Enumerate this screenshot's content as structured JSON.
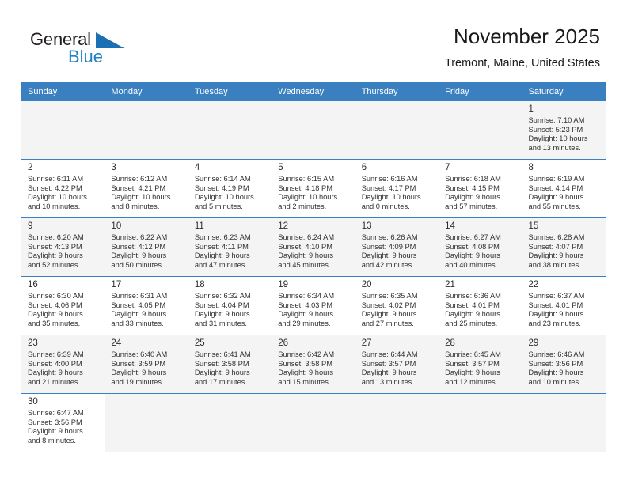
{
  "brand": {
    "name_top": "General",
    "name_bottom": "Blue",
    "flag_icon": "blue-triangle-flag-icon",
    "color_top": "#231f20",
    "color_bottom": "#2280c4"
  },
  "header": {
    "title": "November 2025",
    "subtitle": "Tremont, Maine, United States"
  },
  "theme": {
    "header_bg": "#3a7fbf",
    "header_text": "#ffffff",
    "row_shaded": "#f4f4f4",
    "row_plain": "#ffffff",
    "row_border": "#3a7fbf"
  },
  "calendar": {
    "weekday_headers": [
      "Sunday",
      "Monday",
      "Tuesday",
      "Wednesday",
      "Thursday",
      "Friday",
      "Saturday"
    ],
    "labels": {
      "sunrise": "Sunrise:",
      "sunset": "Sunset:",
      "daylight": "Daylight:"
    },
    "weeks": [
      [
        null,
        null,
        null,
        null,
        null,
        null,
        {
          "day": "1",
          "sunrise": "Sunrise: 7:10 AM",
          "sunset": "Sunset: 5:23 PM",
          "daylight_line1": "Daylight: 10 hours",
          "daylight_line2": "and 13 minutes."
        }
      ],
      [
        {
          "day": "2",
          "sunrise": "Sunrise: 6:11 AM",
          "sunset": "Sunset: 4:22 PM",
          "daylight_line1": "Daylight: 10 hours",
          "daylight_line2": "and 10 minutes."
        },
        {
          "day": "3",
          "sunrise": "Sunrise: 6:12 AM",
          "sunset": "Sunset: 4:21 PM",
          "daylight_line1": "Daylight: 10 hours",
          "daylight_line2": "and 8 minutes."
        },
        {
          "day": "4",
          "sunrise": "Sunrise: 6:14 AM",
          "sunset": "Sunset: 4:19 PM",
          "daylight_line1": "Daylight: 10 hours",
          "daylight_line2": "and 5 minutes."
        },
        {
          "day": "5",
          "sunrise": "Sunrise: 6:15 AM",
          "sunset": "Sunset: 4:18 PM",
          "daylight_line1": "Daylight: 10 hours",
          "daylight_line2": "and 2 minutes."
        },
        {
          "day": "6",
          "sunrise": "Sunrise: 6:16 AM",
          "sunset": "Sunset: 4:17 PM",
          "daylight_line1": "Daylight: 10 hours",
          "daylight_line2": "and 0 minutes."
        },
        {
          "day": "7",
          "sunrise": "Sunrise: 6:18 AM",
          "sunset": "Sunset: 4:15 PM",
          "daylight_line1": "Daylight: 9 hours",
          "daylight_line2": "and 57 minutes."
        },
        {
          "day": "8",
          "sunrise": "Sunrise: 6:19 AM",
          "sunset": "Sunset: 4:14 PM",
          "daylight_line1": "Daylight: 9 hours",
          "daylight_line2": "and 55 minutes."
        }
      ],
      [
        {
          "day": "9",
          "sunrise": "Sunrise: 6:20 AM",
          "sunset": "Sunset: 4:13 PM",
          "daylight_line1": "Daylight: 9 hours",
          "daylight_line2": "and 52 minutes."
        },
        {
          "day": "10",
          "sunrise": "Sunrise: 6:22 AM",
          "sunset": "Sunset: 4:12 PM",
          "daylight_line1": "Daylight: 9 hours",
          "daylight_line2": "and 50 minutes."
        },
        {
          "day": "11",
          "sunrise": "Sunrise: 6:23 AM",
          "sunset": "Sunset: 4:11 PM",
          "daylight_line1": "Daylight: 9 hours",
          "daylight_line2": "and 47 minutes."
        },
        {
          "day": "12",
          "sunrise": "Sunrise: 6:24 AM",
          "sunset": "Sunset: 4:10 PM",
          "daylight_line1": "Daylight: 9 hours",
          "daylight_line2": "and 45 minutes."
        },
        {
          "day": "13",
          "sunrise": "Sunrise: 6:26 AM",
          "sunset": "Sunset: 4:09 PM",
          "daylight_line1": "Daylight: 9 hours",
          "daylight_line2": "and 42 minutes."
        },
        {
          "day": "14",
          "sunrise": "Sunrise: 6:27 AM",
          "sunset": "Sunset: 4:08 PM",
          "daylight_line1": "Daylight: 9 hours",
          "daylight_line2": "and 40 minutes."
        },
        {
          "day": "15",
          "sunrise": "Sunrise: 6:28 AM",
          "sunset": "Sunset: 4:07 PM",
          "daylight_line1": "Daylight: 9 hours",
          "daylight_line2": "and 38 minutes."
        }
      ],
      [
        {
          "day": "16",
          "sunrise": "Sunrise: 6:30 AM",
          "sunset": "Sunset: 4:06 PM",
          "daylight_line1": "Daylight: 9 hours",
          "daylight_line2": "and 35 minutes."
        },
        {
          "day": "17",
          "sunrise": "Sunrise: 6:31 AM",
          "sunset": "Sunset: 4:05 PM",
          "daylight_line1": "Daylight: 9 hours",
          "daylight_line2": "and 33 minutes."
        },
        {
          "day": "18",
          "sunrise": "Sunrise: 6:32 AM",
          "sunset": "Sunset: 4:04 PM",
          "daylight_line1": "Daylight: 9 hours",
          "daylight_line2": "and 31 minutes."
        },
        {
          "day": "19",
          "sunrise": "Sunrise: 6:34 AM",
          "sunset": "Sunset: 4:03 PM",
          "daylight_line1": "Daylight: 9 hours",
          "daylight_line2": "and 29 minutes."
        },
        {
          "day": "20",
          "sunrise": "Sunrise: 6:35 AM",
          "sunset": "Sunset: 4:02 PM",
          "daylight_line1": "Daylight: 9 hours",
          "daylight_line2": "and 27 minutes."
        },
        {
          "day": "21",
          "sunrise": "Sunrise: 6:36 AM",
          "sunset": "Sunset: 4:01 PM",
          "daylight_line1": "Daylight: 9 hours",
          "daylight_line2": "and 25 minutes."
        },
        {
          "day": "22",
          "sunrise": "Sunrise: 6:37 AM",
          "sunset": "Sunset: 4:01 PM",
          "daylight_line1": "Daylight: 9 hours",
          "daylight_line2": "and 23 minutes."
        }
      ],
      [
        {
          "day": "23",
          "sunrise": "Sunrise: 6:39 AM",
          "sunset": "Sunset: 4:00 PM",
          "daylight_line1": "Daylight: 9 hours",
          "daylight_line2": "and 21 minutes."
        },
        {
          "day": "24",
          "sunrise": "Sunrise: 6:40 AM",
          "sunset": "Sunset: 3:59 PM",
          "daylight_line1": "Daylight: 9 hours",
          "daylight_line2": "and 19 minutes."
        },
        {
          "day": "25",
          "sunrise": "Sunrise: 6:41 AM",
          "sunset": "Sunset: 3:58 PM",
          "daylight_line1": "Daylight: 9 hours",
          "daylight_line2": "and 17 minutes."
        },
        {
          "day": "26",
          "sunrise": "Sunrise: 6:42 AM",
          "sunset": "Sunset: 3:58 PM",
          "daylight_line1": "Daylight: 9 hours",
          "daylight_line2": "and 15 minutes."
        },
        {
          "day": "27",
          "sunrise": "Sunrise: 6:44 AM",
          "sunset": "Sunset: 3:57 PM",
          "daylight_line1": "Daylight: 9 hours",
          "daylight_line2": "and 13 minutes."
        },
        {
          "day": "28",
          "sunrise": "Sunrise: 6:45 AM",
          "sunset": "Sunset: 3:57 PM",
          "daylight_line1": "Daylight: 9 hours",
          "daylight_line2": "and 12 minutes."
        },
        {
          "day": "29",
          "sunrise": "Sunrise: 6:46 AM",
          "sunset": "Sunset: 3:56 PM",
          "daylight_line1": "Daylight: 9 hours",
          "daylight_line2": "and 10 minutes."
        }
      ],
      [
        {
          "day": "30",
          "sunrise": "Sunrise: 6:47 AM",
          "sunset": "Sunset: 3:56 PM",
          "daylight_line1": "Daylight: 9 hours",
          "daylight_line2": "and 8 minutes."
        },
        null,
        null,
        null,
        null,
        null,
        null
      ]
    ]
  }
}
